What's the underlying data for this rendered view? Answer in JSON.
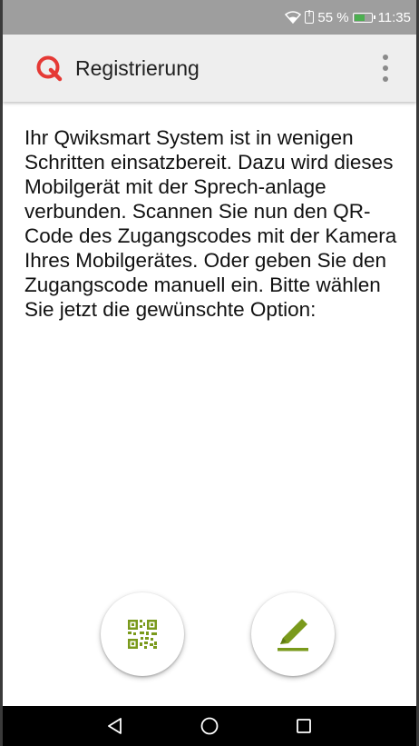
{
  "status_bar": {
    "battery_percent": "55 %",
    "time": "11:35",
    "icons": [
      "wifi-icon",
      "sim-alert-icon",
      "battery-icon"
    ]
  },
  "app_bar": {
    "title": "Registrierung",
    "logo_icon": "qwiksmart-logo-icon",
    "menu_icon": "overflow-menu-icon"
  },
  "content": {
    "instructions": "Ihr Qwiksmart System ist in wenigen Schritten einsatzbereit. Dazu wird dieses Mobilgerät mit der Sprech-anlage verbunden. Scannen Sie nun den QR-Code des Zugangscodes mit der Kamera Ihres Mobilgerätes. Oder geben Sie den Zugangscode manuell ein. Bitte wählen Sie jetzt die gewünschte Option:"
  },
  "actions": {
    "scan_qr_icon": "qr-code-icon",
    "manual_entry_icon": "pencil-icon"
  },
  "navigation": {
    "back_icon": "back-triangle-icon",
    "home_icon": "home-circle-icon",
    "recents_icon": "recents-square-icon"
  },
  "colors": {
    "accent_red": "#e53935",
    "accent_green": "#7a9a1c",
    "status_bar": "#9e9e9e",
    "app_bar": "#eeeeee"
  }
}
